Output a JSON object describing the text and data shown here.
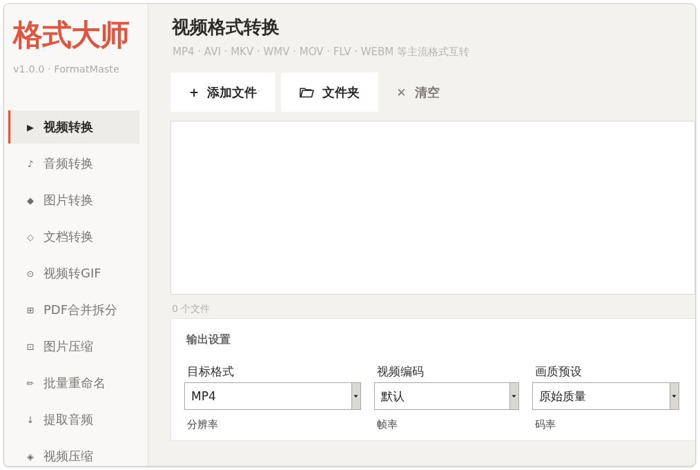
{
  "sidebar": {
    "logo": "格式大师",
    "version": "v1.0.0 · FormatMaste",
    "items": [
      {
        "icon": "▶",
        "label": "视频转换",
        "selected": true
      },
      {
        "icon": "♪",
        "label": "音频转换",
        "selected": false
      },
      {
        "icon": "◆",
        "label": "图片转换",
        "selected": false
      },
      {
        "icon": "◇",
        "label": "文档转换",
        "selected": false
      },
      {
        "icon": "⊙",
        "label": "视频转GIF",
        "selected": false
      },
      {
        "icon": "⊞",
        "label": "PDF合并拆分",
        "selected": false
      },
      {
        "icon": "⊡",
        "label": "图片压缩",
        "selected": false
      },
      {
        "icon": "✏",
        "label": "批量重命名",
        "selected": false
      },
      {
        "icon": "↓",
        "label": "提取音频",
        "selected": false
      },
      {
        "icon": "◈",
        "label": "视频压缩",
        "selected": false
      }
    ]
  },
  "header": {
    "title": "视频格式转换",
    "subtitle": "MP4 · AVI · MKV · WMV · MOV · FLV · WEBM 等主流格式互转"
  },
  "toolbar": [
    {
      "kind": "add",
      "icon": "+",
      "label": "添加文件"
    },
    {
      "kind": "folder",
      "label": "文件夹"
    },
    {
      "kind": "clear",
      "icon": "✕",
      "label": "清空"
    }
  ],
  "file_count": "0 个文件",
  "output_settings": {
    "title": "输出设置",
    "fields": [
      {
        "label": "目标格式",
        "value": "MP4"
      },
      {
        "label": "视频编码",
        "value": "默认"
      },
      {
        "label": "画质预设",
        "value": "原始质量"
      }
    ],
    "more_fields": [
      "分辨率",
      "帧率",
      "码率"
    ]
  }
}
